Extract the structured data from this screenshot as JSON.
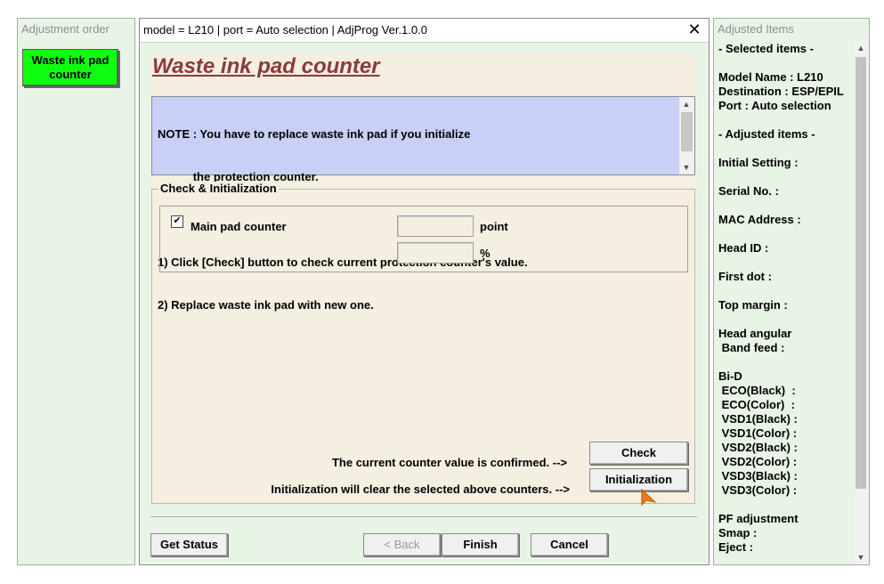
{
  "left_panel": {
    "title": "Adjustment order",
    "step_button": "Waste ink pad\ncounter",
    "step_button_color": "#10ff10"
  },
  "window": {
    "title": "model = L210 | port = Auto selection | AdjProg Ver.1.0.0",
    "close_glyph": "✕",
    "heading": "Waste ink pad counter",
    "heading_color": "#8b3a3a",
    "note_lines": [
      "NOTE : You have to replace waste ink pad if you initialize",
      "           the protection counter.",
      "",
      "1) Click [Check] button to check current protection counter's value.",
      "2) Replace waste ink pad with new one."
    ],
    "note_bg": "#c8d0f8",
    "group_title": "Check & Initialization",
    "checkbox": {
      "checked": true,
      "mark": "✔",
      "label": "Main pad counter"
    },
    "fields": {
      "point_value": "",
      "point_unit": "point",
      "percent_value": "",
      "percent_unit": "%"
    },
    "check_message": "The current counter value is confirmed. -->",
    "check_button": "Check",
    "init_message": "Initialization will clear the selected above counters. -->",
    "init_button": "Initialization",
    "footer": {
      "get_status": "Get Status",
      "back": "< Back",
      "finish": "Finish",
      "cancel": "Cancel"
    }
  },
  "right_panel": {
    "title": "Adjusted Items",
    "lines": [
      "- Selected items -",
      "",
      "Model Name : L210",
      "Destination : ESP/EPIL",
      "Port : Auto selection",
      "",
      "- Adjusted items -",
      "",
      "Initial Setting :",
      "",
      "Serial No. :",
      "",
      "MAC Address :",
      "",
      "Head ID :",
      "",
      "First dot :",
      "",
      "Top margin :",
      "",
      "Head angular",
      " Band feed :",
      "",
      "Bi-D",
      " ECO(Black)  :",
      " ECO(Color)  :",
      " VSD1(Black) :",
      " VSD1(Color) :",
      " VSD2(Black) :",
      " VSD2(Color) :",
      " VSD3(Black) :",
      " VSD3(Color) :",
      "",
      "PF adjustment",
      "Smap :",
      "Eject :"
    ],
    "scroll_up": "▲",
    "scroll_down": "▼"
  }
}
